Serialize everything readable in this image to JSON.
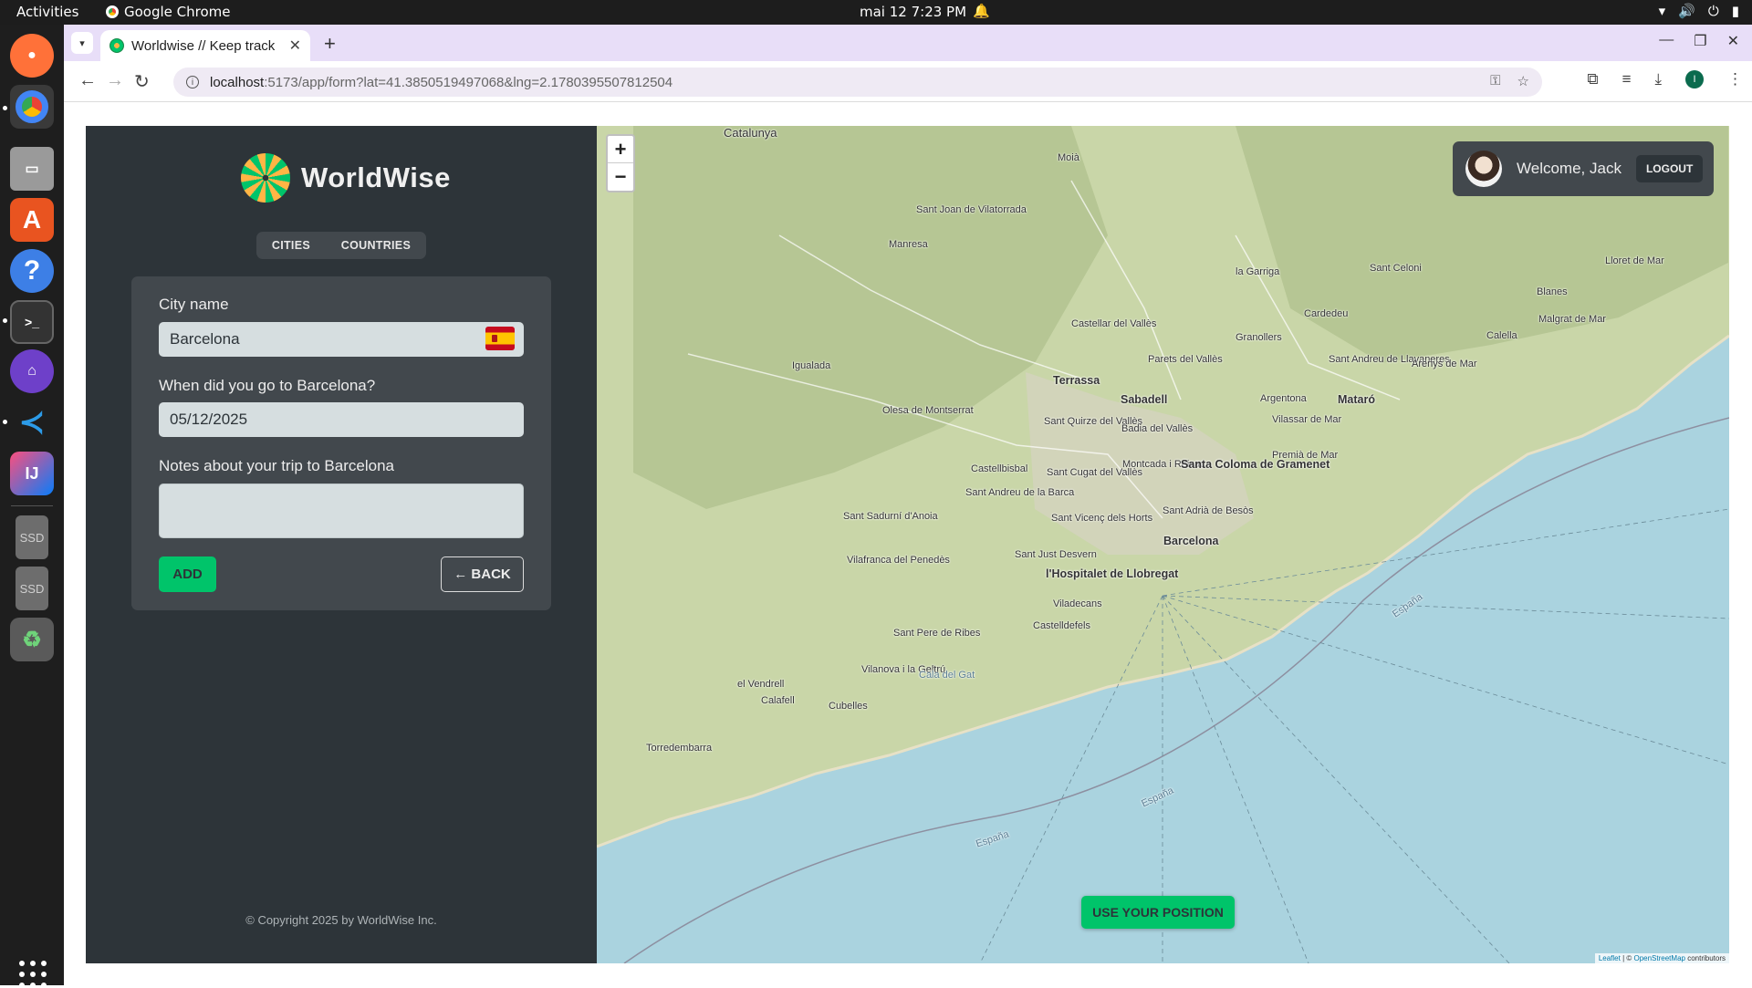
{
  "system": {
    "activities": "Activities",
    "app_name": "Google Chrome",
    "clock": "mai 12  7:23 PM"
  },
  "browser": {
    "tab_title": "Worldwise // Keep track",
    "url_host": "localhost",
    "url_path": ":5173/app/form?lat=41.3850519497068&lng=2.1780395507812504",
    "profile_initial": "I"
  },
  "app": {
    "logo_text": "WorldWise",
    "nav": {
      "cities": "CITIES",
      "countries": "COUNTRIES"
    },
    "form": {
      "city_label": "City name",
      "city_value": "Barcelona",
      "date_label": "When did you go to Barcelona?",
      "date_value": "05/12/2025",
      "notes_label": "Notes about your trip to Barcelona",
      "notes_value": "",
      "add_label": "ADD",
      "back_label": "← BACK"
    },
    "copyright": "© Copyright 2025 by WorldWise Inc.",
    "user": {
      "welcome": "Welcome, Jack",
      "logout_label": "LOGOUT"
    },
    "use_position_label": "USE YOUR POSITION",
    "zoom_in": "+",
    "zoom_out": "−"
  },
  "map": {
    "attribution_leaflet": "Leaflet",
    "attribution_osm": "OpenStreetMap",
    "attribution_suffix": " contributors",
    "labels": {
      "catalunya": "Catalunya",
      "moia": "Moià",
      "sant_joan": "Sant Joan de Vilatorrada",
      "manresa": "Manresa",
      "la_garriga": "la Garriga",
      "sant_celoni": "Sant Celoni",
      "cardedeu": "Cardedeu",
      "castellar": "Castellar del Vallès",
      "granollers": "Granollers",
      "igualada": "Igualada",
      "parets": "Parets del Vallès",
      "terrassa": "Terrassa",
      "sabadell": "Sabadell",
      "sant_andreu_llavaneres": "Sant Andreu de Llavaneres",
      "arenys": "Arenys de Mar",
      "argentona": "Argentona",
      "mataro": "Mataró",
      "vilassar": "Vilassar de Mar",
      "olesa": "Olesa de Montserrat",
      "sant_quirze": "Sant Quirze del Vallès",
      "badia": "Badia del Vallès",
      "premia": "Premià de Mar",
      "castellbisbal": "Castellbisbal",
      "sant_cugat": "Sant Cugat del Vallès",
      "montcada": "Montcada i Reixac",
      "santa_coloma": "Santa Coloma de Gramenet",
      "sant_andreu_barca": "Sant Andreu de la Barca",
      "sant_sadurni": "Sant Sadurní d'Anoia",
      "sant_vicenc": "Sant Vicenç dels Horts",
      "sant_adria": "Sant Adrià de Besòs",
      "barcelona": "Barcelona",
      "sant_just": "Sant Just Desvern",
      "vilafranca": "Vilafranca del Penedès",
      "hospitalet": "l'Hospitalet de Llobregat",
      "viladecans": "Viladecans",
      "castelldefels": "Castelldefels",
      "sant_pere": "Sant Pere de Ribes",
      "vilanova": "Vilanova i la Geltrú",
      "cala_gat": "Cala del Gat",
      "vendrell": "el Vendrell",
      "calafell": "Calafell",
      "cubelles": "Cubelles",
      "torredembarra": "Torredembarra",
      "blanes": "Blanes",
      "lloret": "Lloret de Mar",
      "malgrat": "Malgrat de Mar",
      "calella": "Calella",
      "espana1": "España",
      "espana2": "España",
      "espana3": "España"
    }
  }
}
